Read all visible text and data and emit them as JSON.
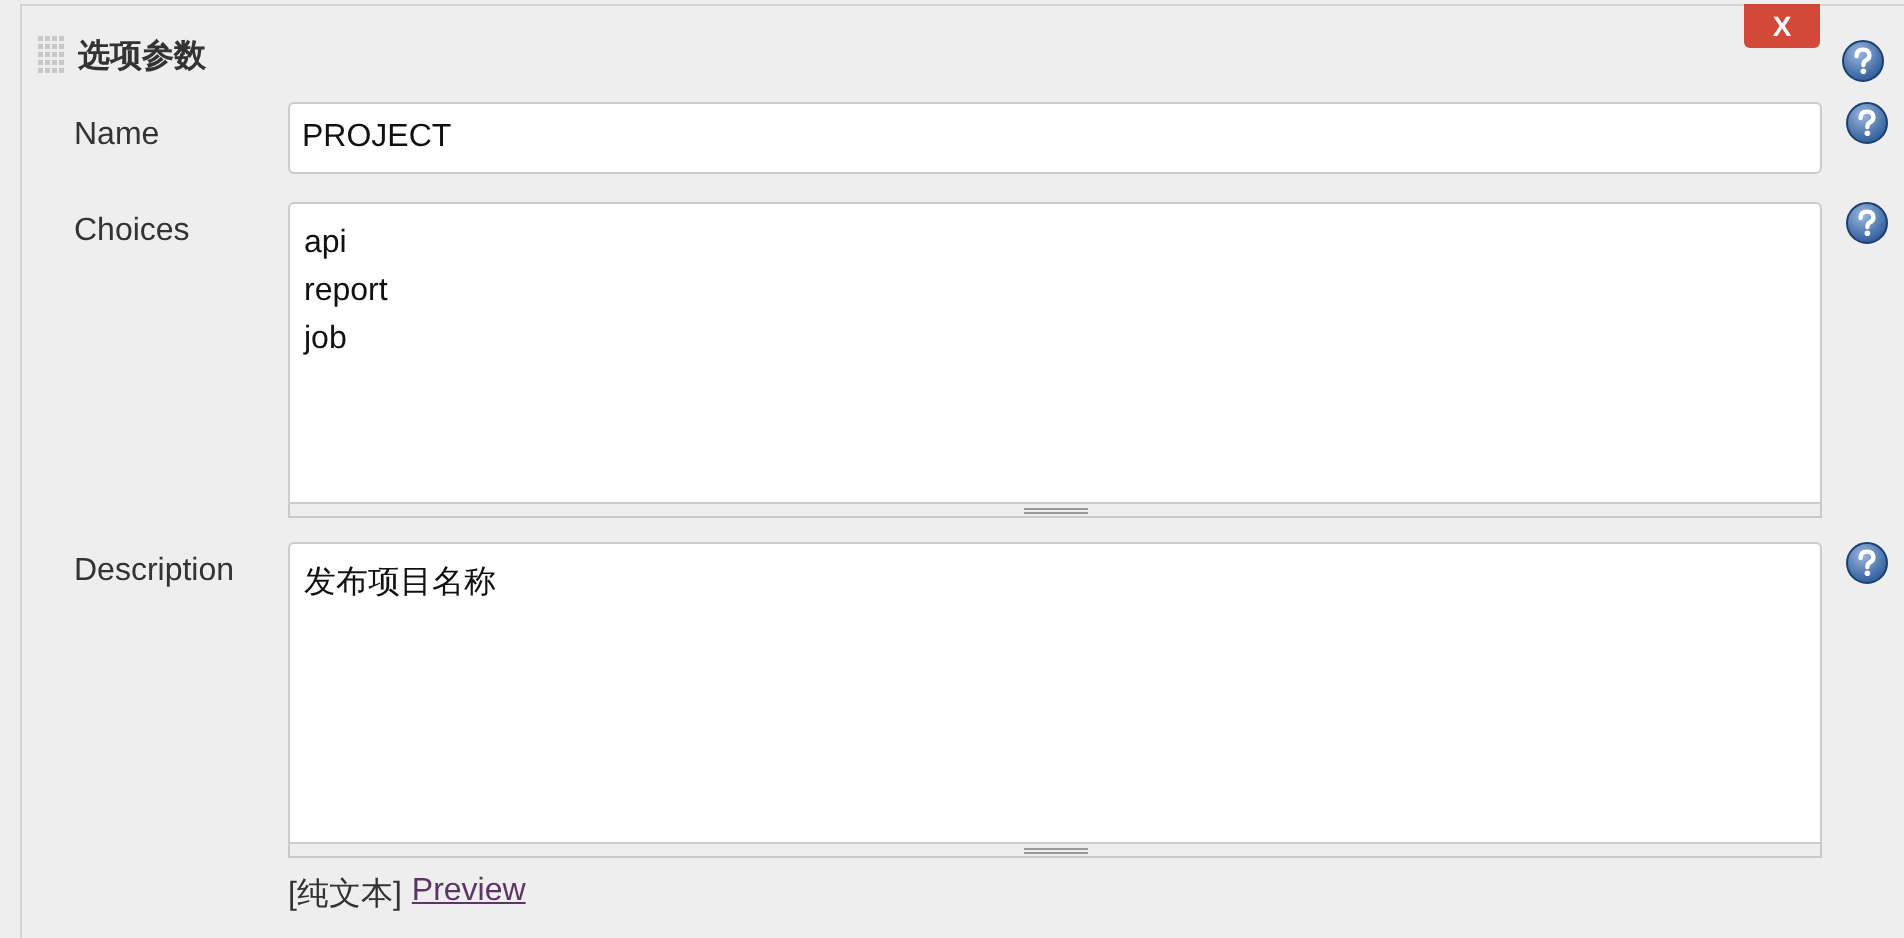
{
  "section": {
    "title": "选项参数",
    "delete_button": "X"
  },
  "fields": [
    {
      "kind": "input",
      "label": "Name",
      "value": "PROJECT"
    },
    {
      "kind": "textarea",
      "label": "Choices",
      "value": "api\nreport\njob"
    },
    {
      "kind": "textarea",
      "label": "Description",
      "value": "发布项目名称"
    }
  ],
  "footer": {
    "format": "[纯文本]",
    "link": "Preview"
  }
}
